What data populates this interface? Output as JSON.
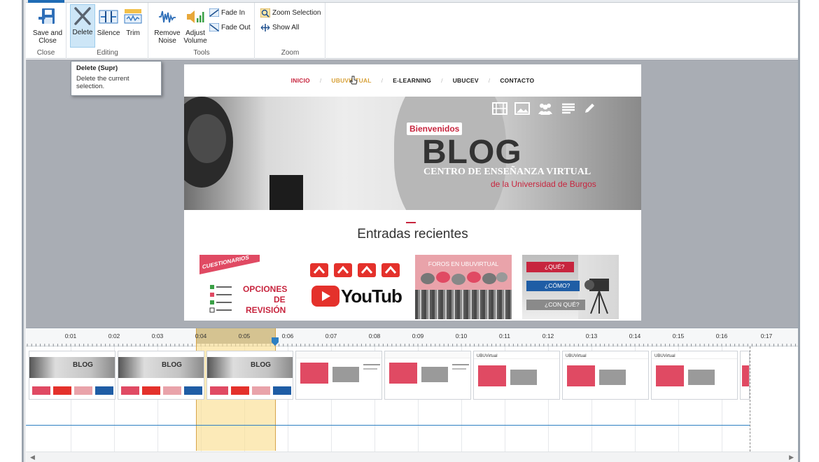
{
  "ribbon": {
    "groups": {
      "close": "Close",
      "editing": "Editing",
      "tools": "Tools",
      "zoom": "Zoom"
    },
    "buttons": {
      "save_close": "Save and Close",
      "delete": "Delete",
      "silence": "Silence",
      "trim": "Trim",
      "remove_noise": "Remove Noise",
      "adjust_volume": "Adjust Volume",
      "fade_in": "Fade In",
      "fade_out": "Fade Out",
      "zoom_selection": "Zoom Selection",
      "show_all": "Show All"
    }
  },
  "tooltip": {
    "title": "Delete (Supr)",
    "body": "Delete the current selection."
  },
  "website": {
    "nav": [
      "INICIO",
      "UBUVIRTUAL",
      "E-LEARNING",
      "UBUCEV",
      "CONTACTO"
    ],
    "hero": {
      "badge": "Bienvenidos",
      "title": "BLOG",
      "subtitle": "CENTRO DE ENSEÑANZA VIRTUAL",
      "subtitle2": "de la Universidad de Burgos"
    },
    "recent_heading": "Entradas recientes",
    "cards": {
      "quiz_banner": "CUESTIONARIOS",
      "quiz_opciones": "OPCIONES",
      "quiz_de": "DE",
      "quiz_revision": "REVISIÓN",
      "youtube": "YouTube",
      "foros": "FOROS EN UBUVIRTUAL",
      "que": "¿QUÉ?",
      "como": "¿CÓMO?",
      "conque": "¿CON QUÉ?"
    }
  },
  "timeline": {
    "ticks": [
      "0:01",
      "0:02",
      "0:03",
      "0:04",
      "0:05",
      "0:06",
      "0:07",
      "0:08",
      "0:09",
      "0:10",
      "0:11",
      "0:12",
      "0:13",
      "0:14",
      "0:15",
      "0:16",
      "0:17"
    ],
    "thumb_blog_label": "BLOG",
    "thumb_app_label": "UBUVirtual"
  },
  "colors": {
    "accent": "#c7253e",
    "selection": "#fbde92",
    "track": "#2d7fc2"
  }
}
